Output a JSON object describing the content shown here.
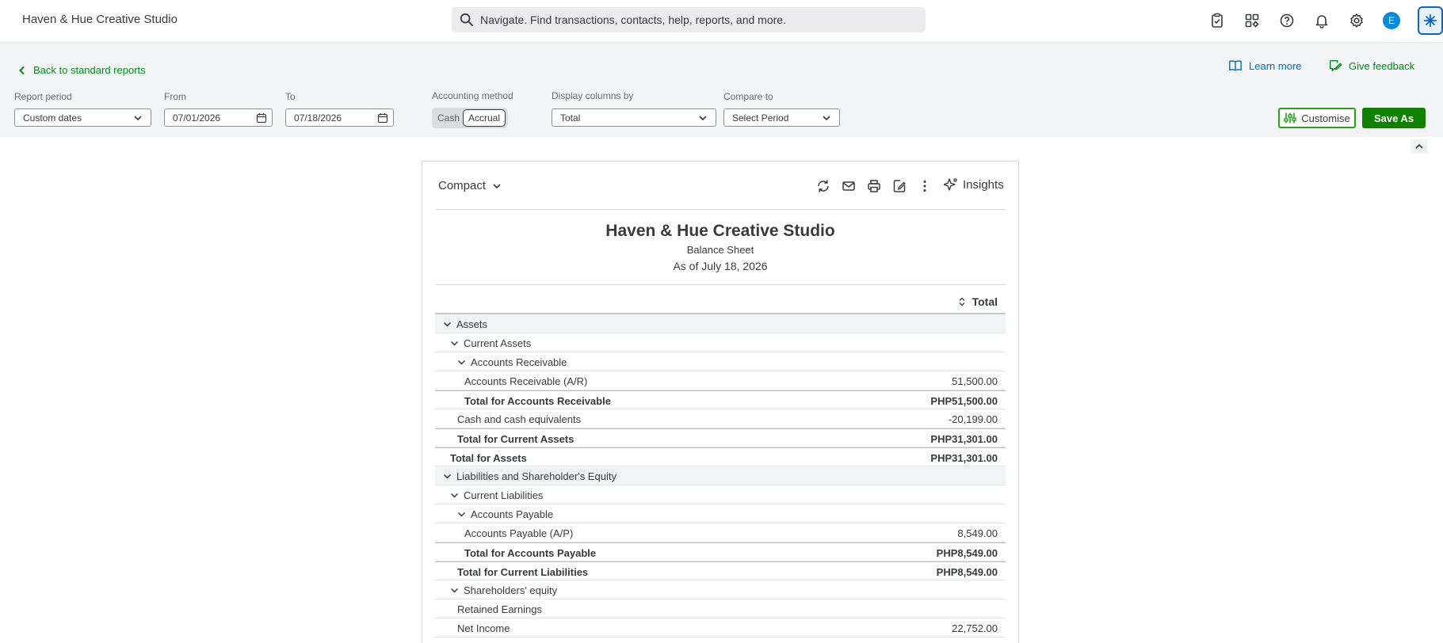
{
  "topbar": {
    "company_name": "Haven & Hue Creative Studio",
    "search_placeholder": "Navigate. Find transactions, contacts, help, reports, and more.",
    "avatar_letter": "E",
    "icons": [
      "clipboard-check-icon",
      "apps-icon",
      "help-icon",
      "bell-icon",
      "gear-icon",
      "sparkle-assistant-icon"
    ]
  },
  "filters": {
    "back_label": "Back to standard reports",
    "learn_more": "Learn more",
    "give_feedback": "Give feedback",
    "report_period_label": "Report period",
    "report_period_value": "Custom dates",
    "from_label": "From",
    "from_value": "07/01/2026",
    "to_label": "To",
    "to_value": "07/18/2026",
    "accounting_method_label": "Accounting method",
    "method_cash": "Cash",
    "method_accrual": "Accrual",
    "method_selected": "Accrual",
    "display_columns_label": "Display columns by",
    "display_columns_value": "Total",
    "compare_label": "Compare to",
    "compare_value": "Select Period",
    "customise_label": "Customise",
    "save_as_label": "Save As"
  },
  "report": {
    "view_mode": "Compact",
    "insights_label": "Insights",
    "company": "Haven & Hue Creative Studio",
    "title": "Balance Sheet",
    "as_of": "As of July 18, 2026",
    "column_header": "Total",
    "rows": [
      {
        "label": "Assets",
        "amount": "",
        "level": 0,
        "type": "section",
        "expand": true
      },
      {
        "label": "Current Assets",
        "amount": "",
        "level": 1,
        "type": "group",
        "expand": true
      },
      {
        "label": "Accounts Receivable",
        "amount": "",
        "level": 2,
        "type": "group",
        "expand": true
      },
      {
        "label": "Accounts Receivable (A/R)",
        "amount": "51,500.00",
        "level": 3,
        "type": "item",
        "expand": false
      },
      {
        "label": "Total for Accounts Receivable",
        "amount": "PHP51,500.00",
        "level": 3,
        "type": "total",
        "expand": false
      },
      {
        "label": "Cash and cash equivalents",
        "amount": "-20,199.00",
        "level": 2,
        "type": "item",
        "expand": false
      },
      {
        "label": "Total for Current Assets",
        "amount": "PHP31,301.00",
        "level": 2,
        "type": "total",
        "expand": false
      },
      {
        "label": "Total for Assets",
        "amount": "PHP31,301.00",
        "level": 1,
        "type": "total",
        "expand": false
      },
      {
        "label": "Liabilities and Shareholder's Equity",
        "amount": "",
        "level": 0,
        "type": "section",
        "expand": true
      },
      {
        "label": "Current Liabilities",
        "amount": "",
        "level": 1,
        "type": "group",
        "expand": true
      },
      {
        "label": "Accounts Payable",
        "amount": "",
        "level": 2,
        "type": "group",
        "expand": true
      },
      {
        "label": "Accounts Payable (A/P)",
        "amount": "8,549.00",
        "level": 3,
        "type": "item",
        "expand": false
      },
      {
        "label": "Total for Accounts Payable",
        "amount": "PHP8,549.00",
        "level": 3,
        "type": "total",
        "expand": false
      },
      {
        "label": "Total for Current Liabilities",
        "amount": "PHP8,549.00",
        "level": 2,
        "type": "total",
        "expand": false
      },
      {
        "label": "Shareholders' equity",
        "amount": "",
        "level": 1,
        "type": "group",
        "expand": true
      },
      {
        "label": "Retained Earnings",
        "amount": "",
        "level": 2,
        "type": "item",
        "expand": false
      },
      {
        "label": "Net Income",
        "amount": "22,752.00",
        "level": 2,
        "type": "item",
        "expand": false
      }
    ]
  },
  "colors": {
    "green": "#108000",
    "link_green": "#008a1c",
    "link_blue": "#0b6fb6",
    "text": "#393a3d"
  }
}
